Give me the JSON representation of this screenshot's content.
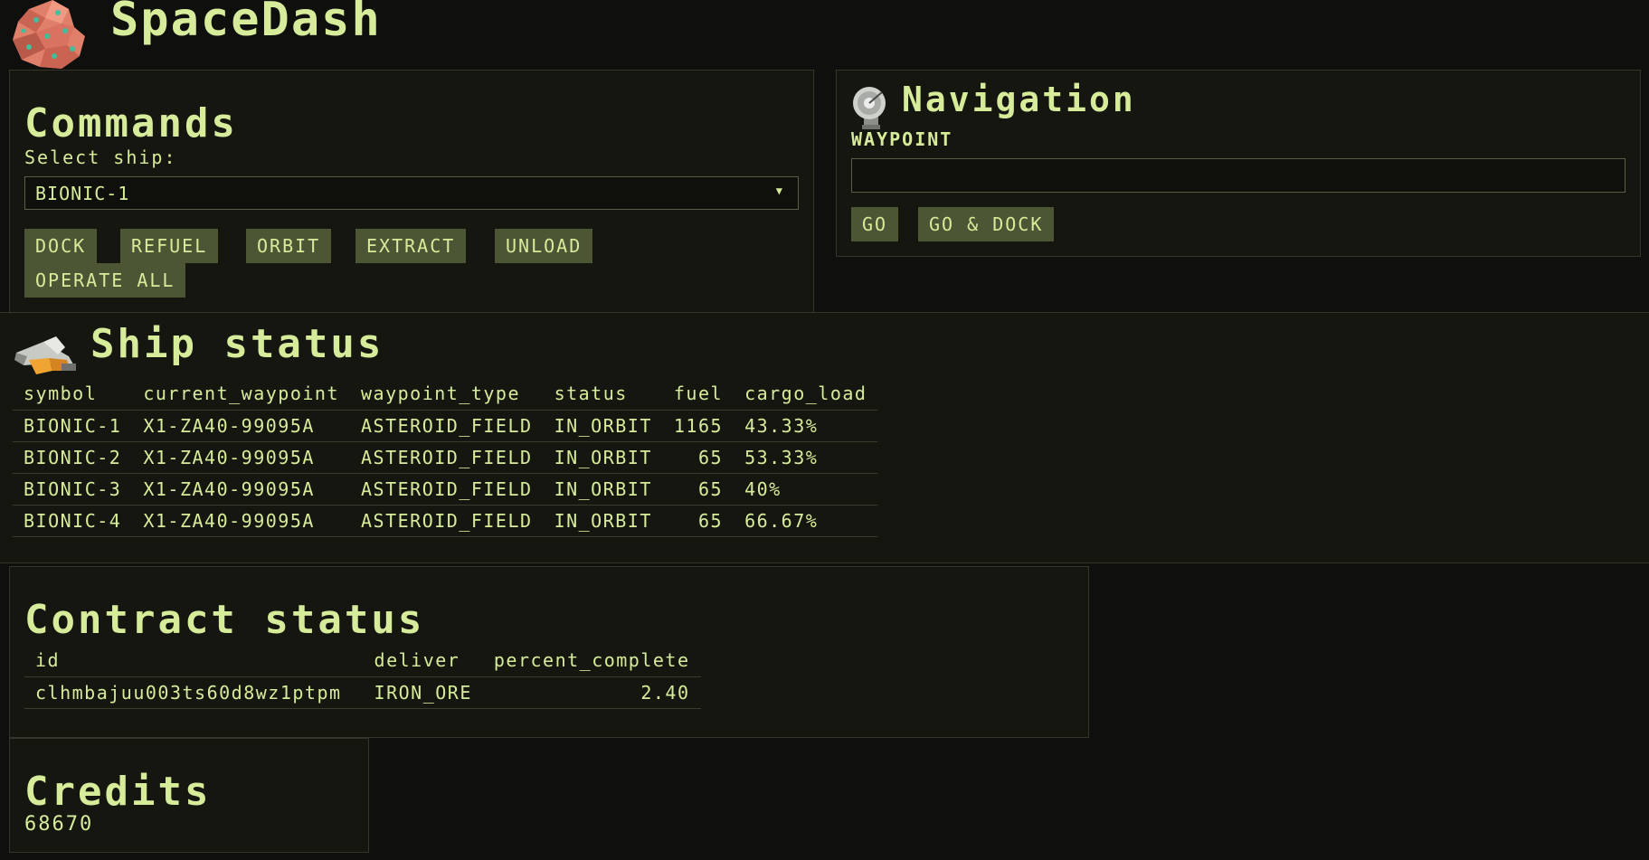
{
  "app": {
    "title": "SpaceDash"
  },
  "colors": {
    "background": "#0f0f0e",
    "panel": "#151610",
    "accent_text": "#d7ec9a",
    "button": "#4c5534"
  },
  "commands": {
    "title": "Commands",
    "select_label": "Select ship:",
    "selected_ship": "BIONIC-1",
    "buttons": [
      "DOCK",
      "REFUEL",
      "ORBIT",
      "EXTRACT",
      "UNLOAD",
      "OPERATE ALL"
    ]
  },
  "navigation": {
    "title": "Navigation",
    "waypoint_label": "WAYPOINT",
    "waypoint_value": "",
    "buttons": [
      "GO",
      "GO & DOCK"
    ]
  },
  "ship_status": {
    "title": "Ship status",
    "columns": [
      "symbol",
      "current_waypoint",
      "waypoint_type",
      "status",
      "fuel",
      "cargo_load"
    ],
    "rows": [
      [
        "BIONIC-1",
        "X1-ZA40-99095A",
        "ASTEROID_FIELD",
        "IN_ORBIT",
        "1165",
        "43.33%"
      ],
      [
        "BIONIC-2",
        "X1-ZA40-99095A",
        "ASTEROID_FIELD",
        "IN_ORBIT",
        "65",
        "53.33%"
      ],
      [
        "BIONIC-3",
        "X1-ZA40-99095A",
        "ASTEROID_FIELD",
        "IN_ORBIT",
        "65",
        "40%"
      ],
      [
        "BIONIC-4",
        "X1-ZA40-99095A",
        "ASTEROID_FIELD",
        "IN_ORBIT",
        "65",
        "66.67%"
      ]
    ]
  },
  "contract_status": {
    "title": "Contract status",
    "columns": [
      "id",
      "deliver",
      "percent_complete"
    ],
    "rows": [
      [
        "clhmbajuu003ts60d8wz1ptpm",
        "IRON_ORE",
        "2.40"
      ]
    ]
  },
  "credits": {
    "title": "Credits",
    "value": "68670"
  }
}
